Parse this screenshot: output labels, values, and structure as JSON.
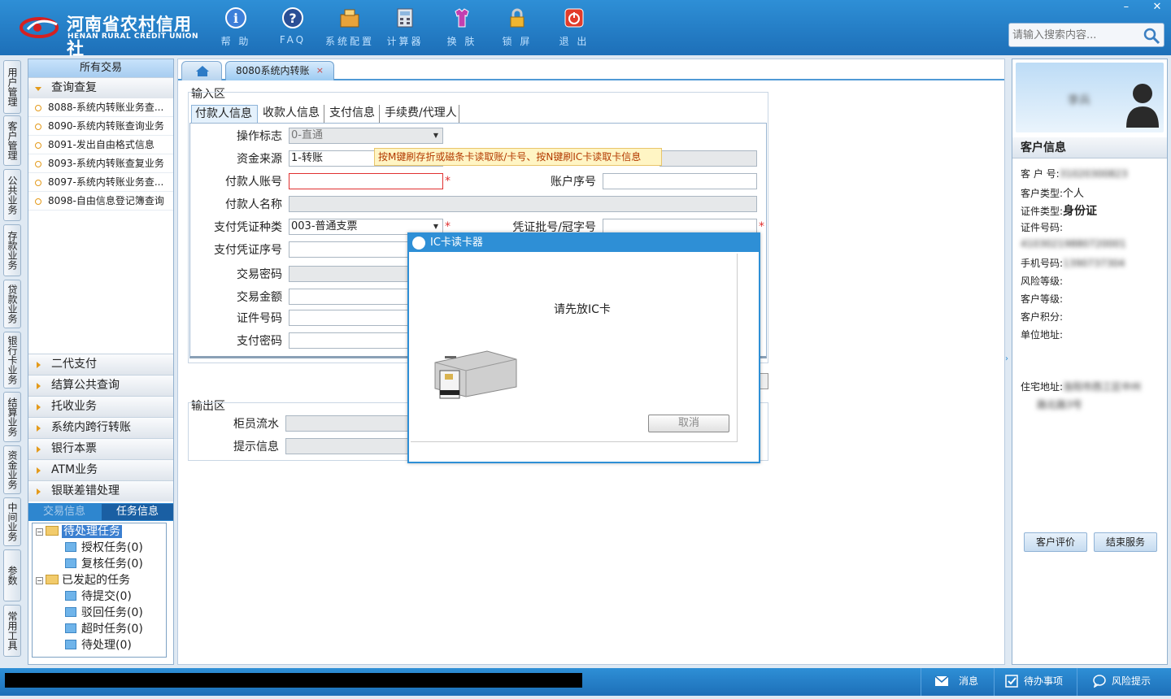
{
  "header": {
    "logo_cn": "河南省农村信用社",
    "logo_en": "HENAN RURAL CREDIT UNION",
    "toolbar": [
      {
        "label": "帮 助",
        "icon": "help-icon"
      },
      {
        "label": "FAQ",
        "icon": "faq-icon"
      },
      {
        "label": "系统配置",
        "icon": "config-icon"
      },
      {
        "label": "计算器",
        "icon": "calculator-icon"
      },
      {
        "label": "换 肤",
        "icon": "skin-icon"
      },
      {
        "label": "锁 屏",
        "icon": "lock-icon"
      },
      {
        "label": "退 出",
        "icon": "exit-icon"
      }
    ],
    "search_placeholder": "请输入搜索内容...",
    "win_min": "–",
    "win_close": "✕"
  },
  "rail": [
    "用户管理",
    "客户管理",
    "公共业务",
    "存款业务",
    "贷款业务",
    "银行卡业务",
    "结算业务",
    "资金业务",
    "中间业务",
    "参数",
    "常用工具"
  ],
  "leftnav": {
    "header": "所有交易",
    "open_group": "查询查复",
    "items": [
      "8088-系统内转账业务查...",
      "8090-系统内转账查询业务",
      "8091-发出自由格式信息",
      "8093-系统内转账查复业务",
      "8097-系统内转账业务查...",
      "8098-自由信息登记簿查询"
    ],
    "groups": [
      "二代支付",
      "结算公共查询",
      "托收业务",
      "系统内跨行转账",
      "银行本票",
      "ATM业务",
      "银联差错处理"
    ],
    "subtabs": [
      "交易信息",
      "任务信息"
    ],
    "tree": {
      "pending": "待处理任务",
      "auth": "授权任务(0)",
      "review": "复核任务(0)",
      "initiated": "已发起的任务",
      "submit": "待提交(0)",
      "rejected": "驳回任务(0)",
      "timeout": "超时任务(0)",
      "todo": "待处理(0)"
    }
  },
  "tabs": {
    "active": "8080系统内转账",
    "close": "×"
  },
  "input_area": {
    "title": "输入区",
    "tabs": [
      "付款人信息",
      "收款人信息",
      "支付信息",
      "手续费/代理人"
    ],
    "labels": {
      "op_flag": "操作标志",
      "fund_source": "资金来源",
      "payer_account": "付款人账号",
      "account_seq": "账户序号",
      "payer_name": "付款人名称",
      "voucher_type": "支付凭证种类",
      "voucher_batch": "凭证批号/冠字号",
      "voucher_seq": "支付凭证序号",
      "tx_password": "交易密码",
      "tx_amount": "交易金额",
      "id_number": "证件号码",
      "pay_password": "支付密码"
    },
    "values": {
      "op_flag": "0-直通",
      "fund_source": "1-转账",
      "voucher_type": "003-普通支票"
    },
    "tooltip": "按M键刷存折或磁条卡读取账/卡号、按N键刷IC卡读取卡信息",
    "required": "*"
  },
  "output_area": {
    "title": "输出区",
    "labels": {
      "teller_serial": "柜员流水",
      "hint": "提示信息"
    }
  },
  "dialog": {
    "title": "IC卡读卡器",
    "message": "请先放IC卡",
    "cancel": "取消"
  },
  "right": {
    "name": "李兵",
    "section": "客户信息",
    "fields": [
      {
        "label": "客 户 号:",
        "value": "31020300823"
      },
      {
        "label": "客户类型:",
        "value": "个人"
      },
      {
        "label": "证件类型:",
        "value": "身份证"
      },
      {
        "label": "证件号码:",
        "value": ""
      },
      {
        "label": "",
        "value": "41030219880720001"
      },
      {
        "label": "手机号码:",
        "value": "1390737304"
      },
      {
        "label": "风险等级:",
        "value": ""
      },
      {
        "label": "客户等级:",
        "value": ""
      },
      {
        "label": "客户积分:",
        "value": ""
      },
      {
        "label": "单位地址:",
        "value": ""
      },
      {
        "label": "住宅地址:",
        "value": "洛阳市西工区中州"
      },
      {
        "label": "",
        "value": "路北路3号"
      }
    ],
    "btn_eval": "客户评价",
    "btn_end": "结束服务"
  },
  "status": {
    "msg": "消息",
    "todo": "待办事项",
    "risk": "风险提示"
  }
}
